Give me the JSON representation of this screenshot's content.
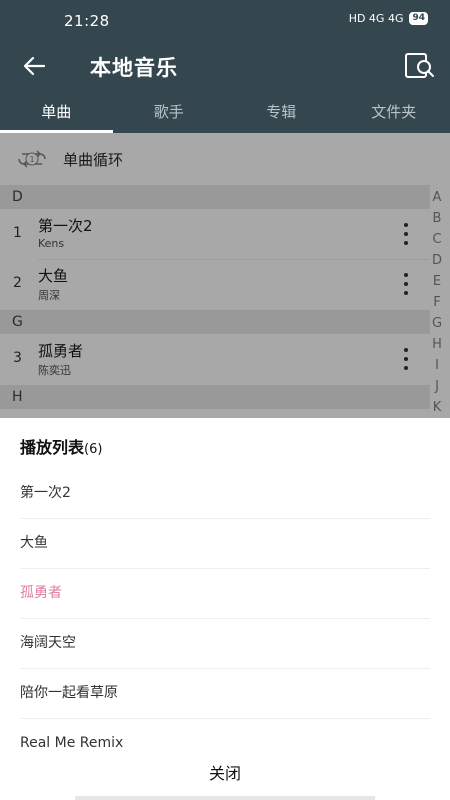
{
  "status_bar": {
    "time": "21:28",
    "icons_text": "HD 4G 4G",
    "battery": "94"
  },
  "header": {
    "title": "本地音乐"
  },
  "tabs": [
    {
      "label": "单曲"
    },
    {
      "label": "歌手"
    },
    {
      "label": "专辑"
    },
    {
      "label": "文件夹"
    }
  ],
  "mode": {
    "label": "单曲循环"
  },
  "sections": {
    "d": "D",
    "g": "G",
    "h": "H"
  },
  "songs": [
    {
      "num": "1",
      "title": "第一次2",
      "artist": "Kens"
    },
    {
      "num": "2",
      "title": "大鱼",
      "artist": "周深"
    },
    {
      "num": "3",
      "title": "孤勇者",
      "artist": "陈奕迅"
    }
  ],
  "alphabet": [
    "A",
    "B",
    "C",
    "D",
    "E",
    "F",
    "G",
    "H",
    "I",
    "J",
    "K"
  ],
  "playlist": {
    "title": "播放列表",
    "count": "(6)",
    "items": [
      {
        "label": "第一次2"
      },
      {
        "label": "大鱼"
      },
      {
        "label": "孤勇者"
      },
      {
        "label": "海阔天空"
      },
      {
        "label": "陪你一起看草原"
      },
      {
        "label": "Real Me Remix"
      }
    ],
    "close_label": "关闭"
  },
  "colors": {
    "header_bg": "#35474e",
    "current_item": "#e07aa4"
  }
}
